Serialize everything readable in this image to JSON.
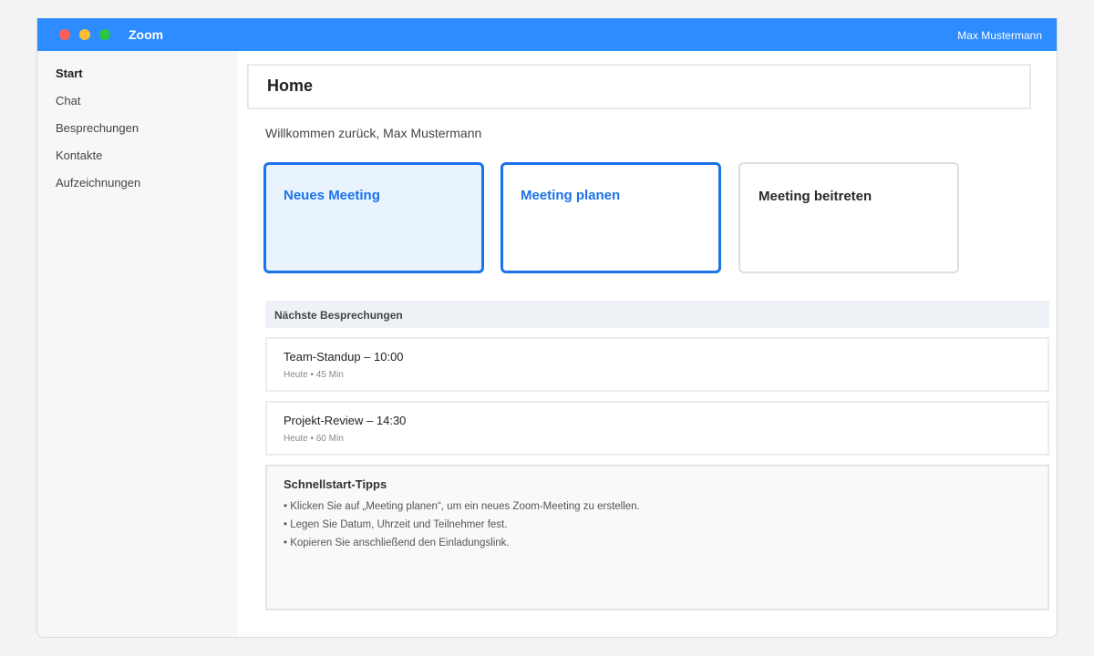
{
  "app": {
    "title": "Zoom",
    "user": "Max Mustermann",
    "accent_color": "#2d8cff"
  },
  "sidebar": {
    "items": [
      {
        "label": "Start",
        "active": true
      },
      {
        "label": "Chat",
        "active": false
      },
      {
        "label": "Besprechungen",
        "active": false
      },
      {
        "label": "Kontakte",
        "active": false
      },
      {
        "label": "Aufzeichnungen",
        "active": false
      }
    ]
  },
  "main": {
    "title": "Home",
    "welcome": "Willkommen zurück, Max Mustermann",
    "actions": {
      "new_meeting": "Neues Meeting",
      "plan_meeting": "Meeting planen",
      "join_meeting": "Meeting beitreten"
    },
    "upcoming": {
      "header": "Nächste Besprechungen",
      "meetings": [
        {
          "title": "Team-Standup – 10:00",
          "meta": "Heute • 45 Min"
        },
        {
          "title": "Projekt-Review – 14:30",
          "meta": "Heute • 60 Min"
        }
      ]
    },
    "tips": {
      "title": "Schnellstart-Tipps",
      "items": [
        "• Klicken Sie auf „Meeting planen“, um ein neues Zoom-Meeting zu erstellen.",
        "• Legen Sie Datum, Uhrzeit und Teilnehmer fest.",
        "• Kopieren Sie anschließend den Einladungslink."
      ]
    }
  }
}
